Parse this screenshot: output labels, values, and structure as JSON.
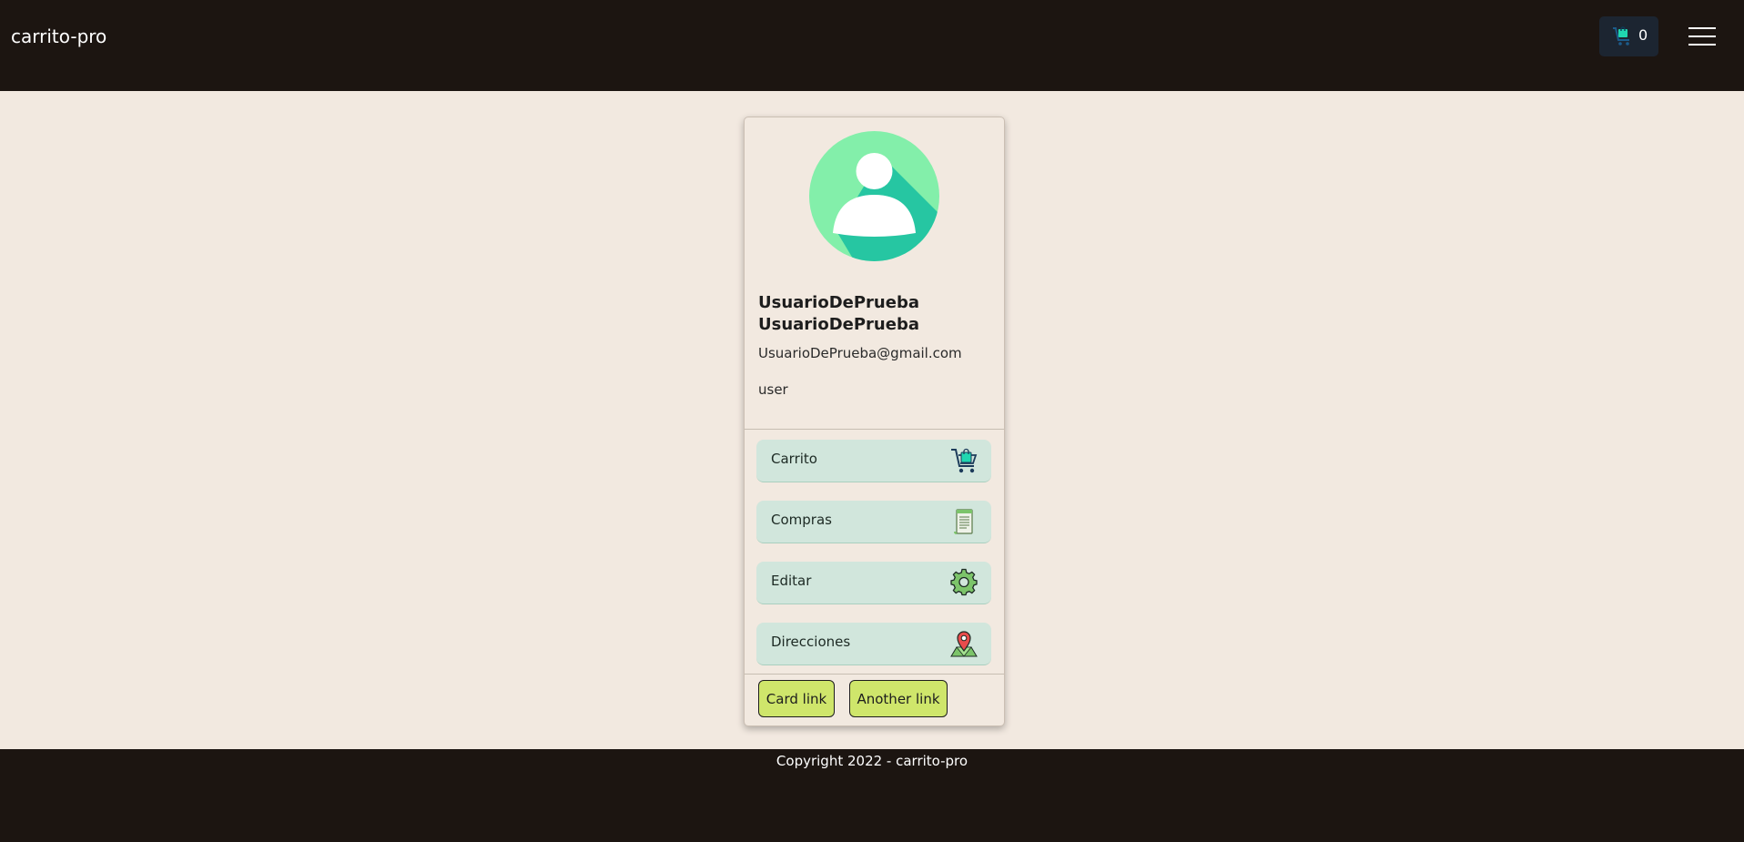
{
  "header": {
    "brand": "carrito-pro",
    "cart_count": "0",
    "cart_icon": "shopping-cart-icon",
    "menu_icon": "hamburger-menu-icon"
  },
  "profile": {
    "avatar_icon": "user-avatar-icon",
    "name": "UsuarioDePrueba UsuarioDePrueba",
    "email": "UsuarioDePrueba@gmail.com",
    "role": "user"
  },
  "menu": [
    {
      "label": "Carrito",
      "icon": "shopping-cart-icon"
    },
    {
      "label": "Compras",
      "icon": "receipt-icon"
    },
    {
      "label": "Editar",
      "icon": "gear-icon"
    },
    {
      "label": "Direcciones",
      "icon": "map-pin-icon"
    }
  ],
  "card_links": {
    "first": "Card link",
    "second": "Another link"
  },
  "footer": {
    "text": "Copyright 2022 - carrito-pro"
  },
  "colors": {
    "header_bg": "#1c1511",
    "page_bg": "#f2e9e0",
    "menu_item_bg": "#d1e6dc",
    "card_link_bg": "#cfe66b",
    "avatar_light": "#83efaa",
    "avatar_dark": "#26c6a2"
  }
}
